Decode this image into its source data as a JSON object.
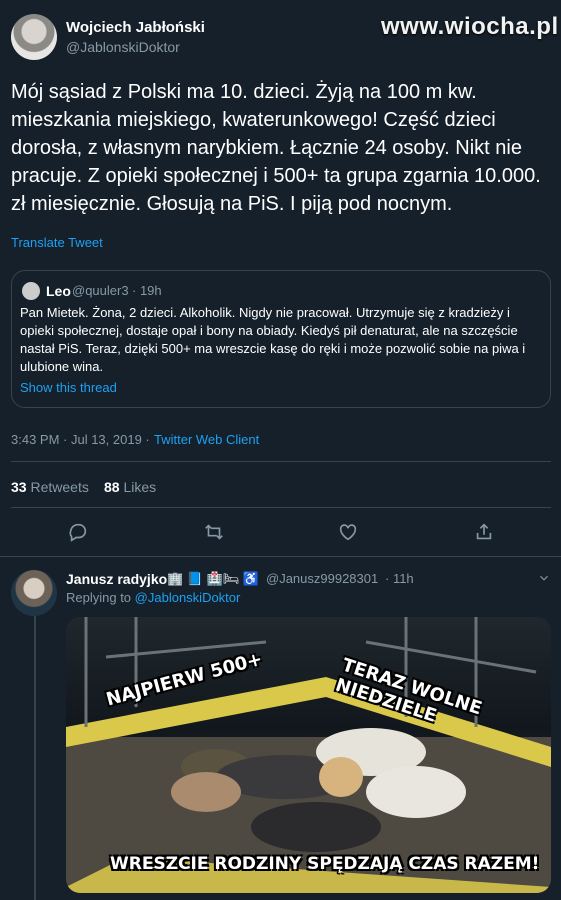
{
  "watermark": "www.wiocha.pl",
  "tweet": {
    "author_name": "Wojciech Jabłoński",
    "author_handle": "@JablonskiDoktor",
    "text": "Mój sąsiad z Polski ma 10. dzieci. Żyją na 100 m kw. mieszkania miejskiego, kwaterunkowego! Część dzieci dorosła, z własnym narybkiem. Łącznie 24 osoby. Nikt nie pracuje. Z opieki społecznej i 500+ ta grupa zgarnia 10.000. zł miesięcznie. Głosują na PiS. I piją pod nocnym.",
    "translate_label": "Translate Tweet",
    "quote": {
      "name": "Leo",
      "handle": "@quuler3",
      "time": "· 19h",
      "text": "Pan Mietek. Żona, 2 dzieci. Alkoholik. Nigdy nie pracował. Utrzymuje się z kradzieży i opieki społecznej, dostaje opał i bony na obiady. Kiedyś pił denaturat, ale na szczęście nastał PiS. Teraz, dzięki 500+ ma wreszcie kasę do ręki i może pozwolić sobie na piwa i ulubione wina.",
      "show_thread": "Show this thread"
    },
    "timestamp": "3:43 PM · Jul 13, 2019 ·",
    "client": "Twitter Web Client",
    "retweets_count": "33",
    "retweets_label": "Retweets",
    "likes_count": "88",
    "likes_label": "Likes"
  },
  "reply": {
    "name": "Janusz radyjko",
    "emoji": "🏢 📘 🏥🛏 ♿",
    "handle": "@Janusz99928301",
    "time": "· 11h",
    "replying_to": "Replying to",
    "replying_handle": "@JablonskiDoktor",
    "image_caption_left": "NAJPIERW 500+",
    "image_caption_right": "TERAZ WOLNE NIEDZIELE",
    "image_caption_bottom": "WRESZCIE RODZINY SPĘDZAJĄ CZAS RAZEM!"
  }
}
